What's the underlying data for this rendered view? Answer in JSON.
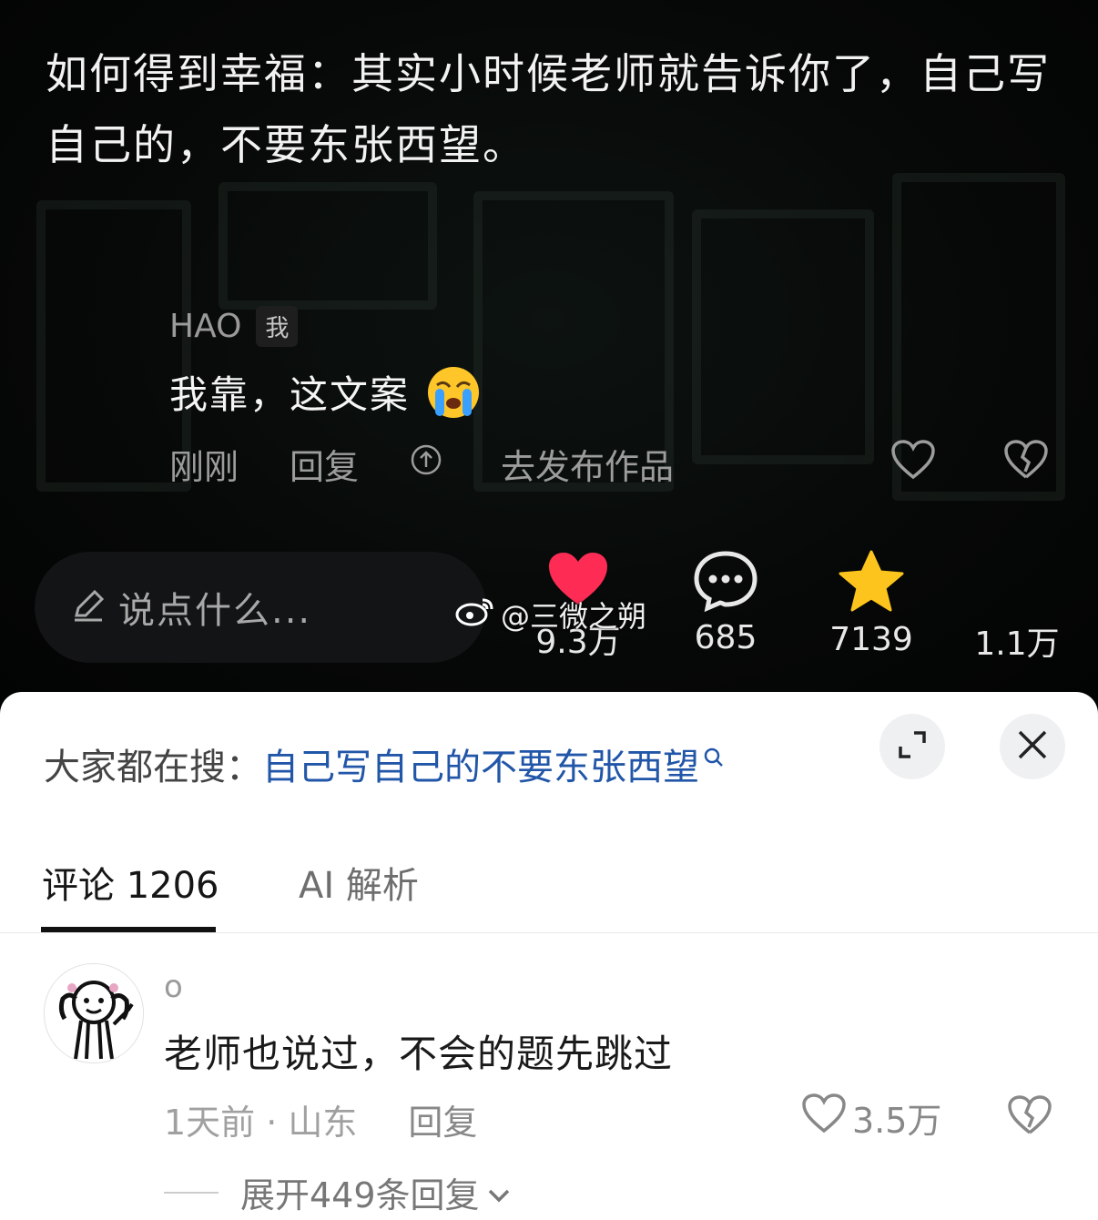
{
  "video": {
    "caption": "如何得到幸福：其实小时候老师就告诉你了，自己写自己的，不要东张西望。"
  },
  "top_comment": {
    "username": "HAO",
    "me_badge": "我",
    "text": "我靠，这文案",
    "emoji": "😭",
    "time": "刚刚",
    "reply": "回复",
    "publish": "去发布作品"
  },
  "input_box": {
    "placeholder": "说点什么..."
  },
  "stats": {
    "likes": "9.3万",
    "comments": "685",
    "favorites": "7139",
    "shares": "1.1万"
  },
  "watermark": "@三微之朔",
  "sheet": {
    "search_label": "大家都在搜：",
    "search_query": "自己写自己的不要东张西望",
    "tabs": [
      {
        "label": "评论 1206",
        "active": true
      },
      {
        "label": "AI 解析",
        "active": false
      }
    ],
    "comment": {
      "username": "o",
      "text": "老师也说过，不会的题先跳过",
      "time_location": "1天前 · 山东",
      "reply": "回复",
      "likes": "3.5万",
      "expand": "展开449条回复"
    }
  },
  "colors": {
    "like_red": "#fe2c55",
    "star_yellow": "#fcc41c",
    "search_blue": "#2156a8"
  }
}
